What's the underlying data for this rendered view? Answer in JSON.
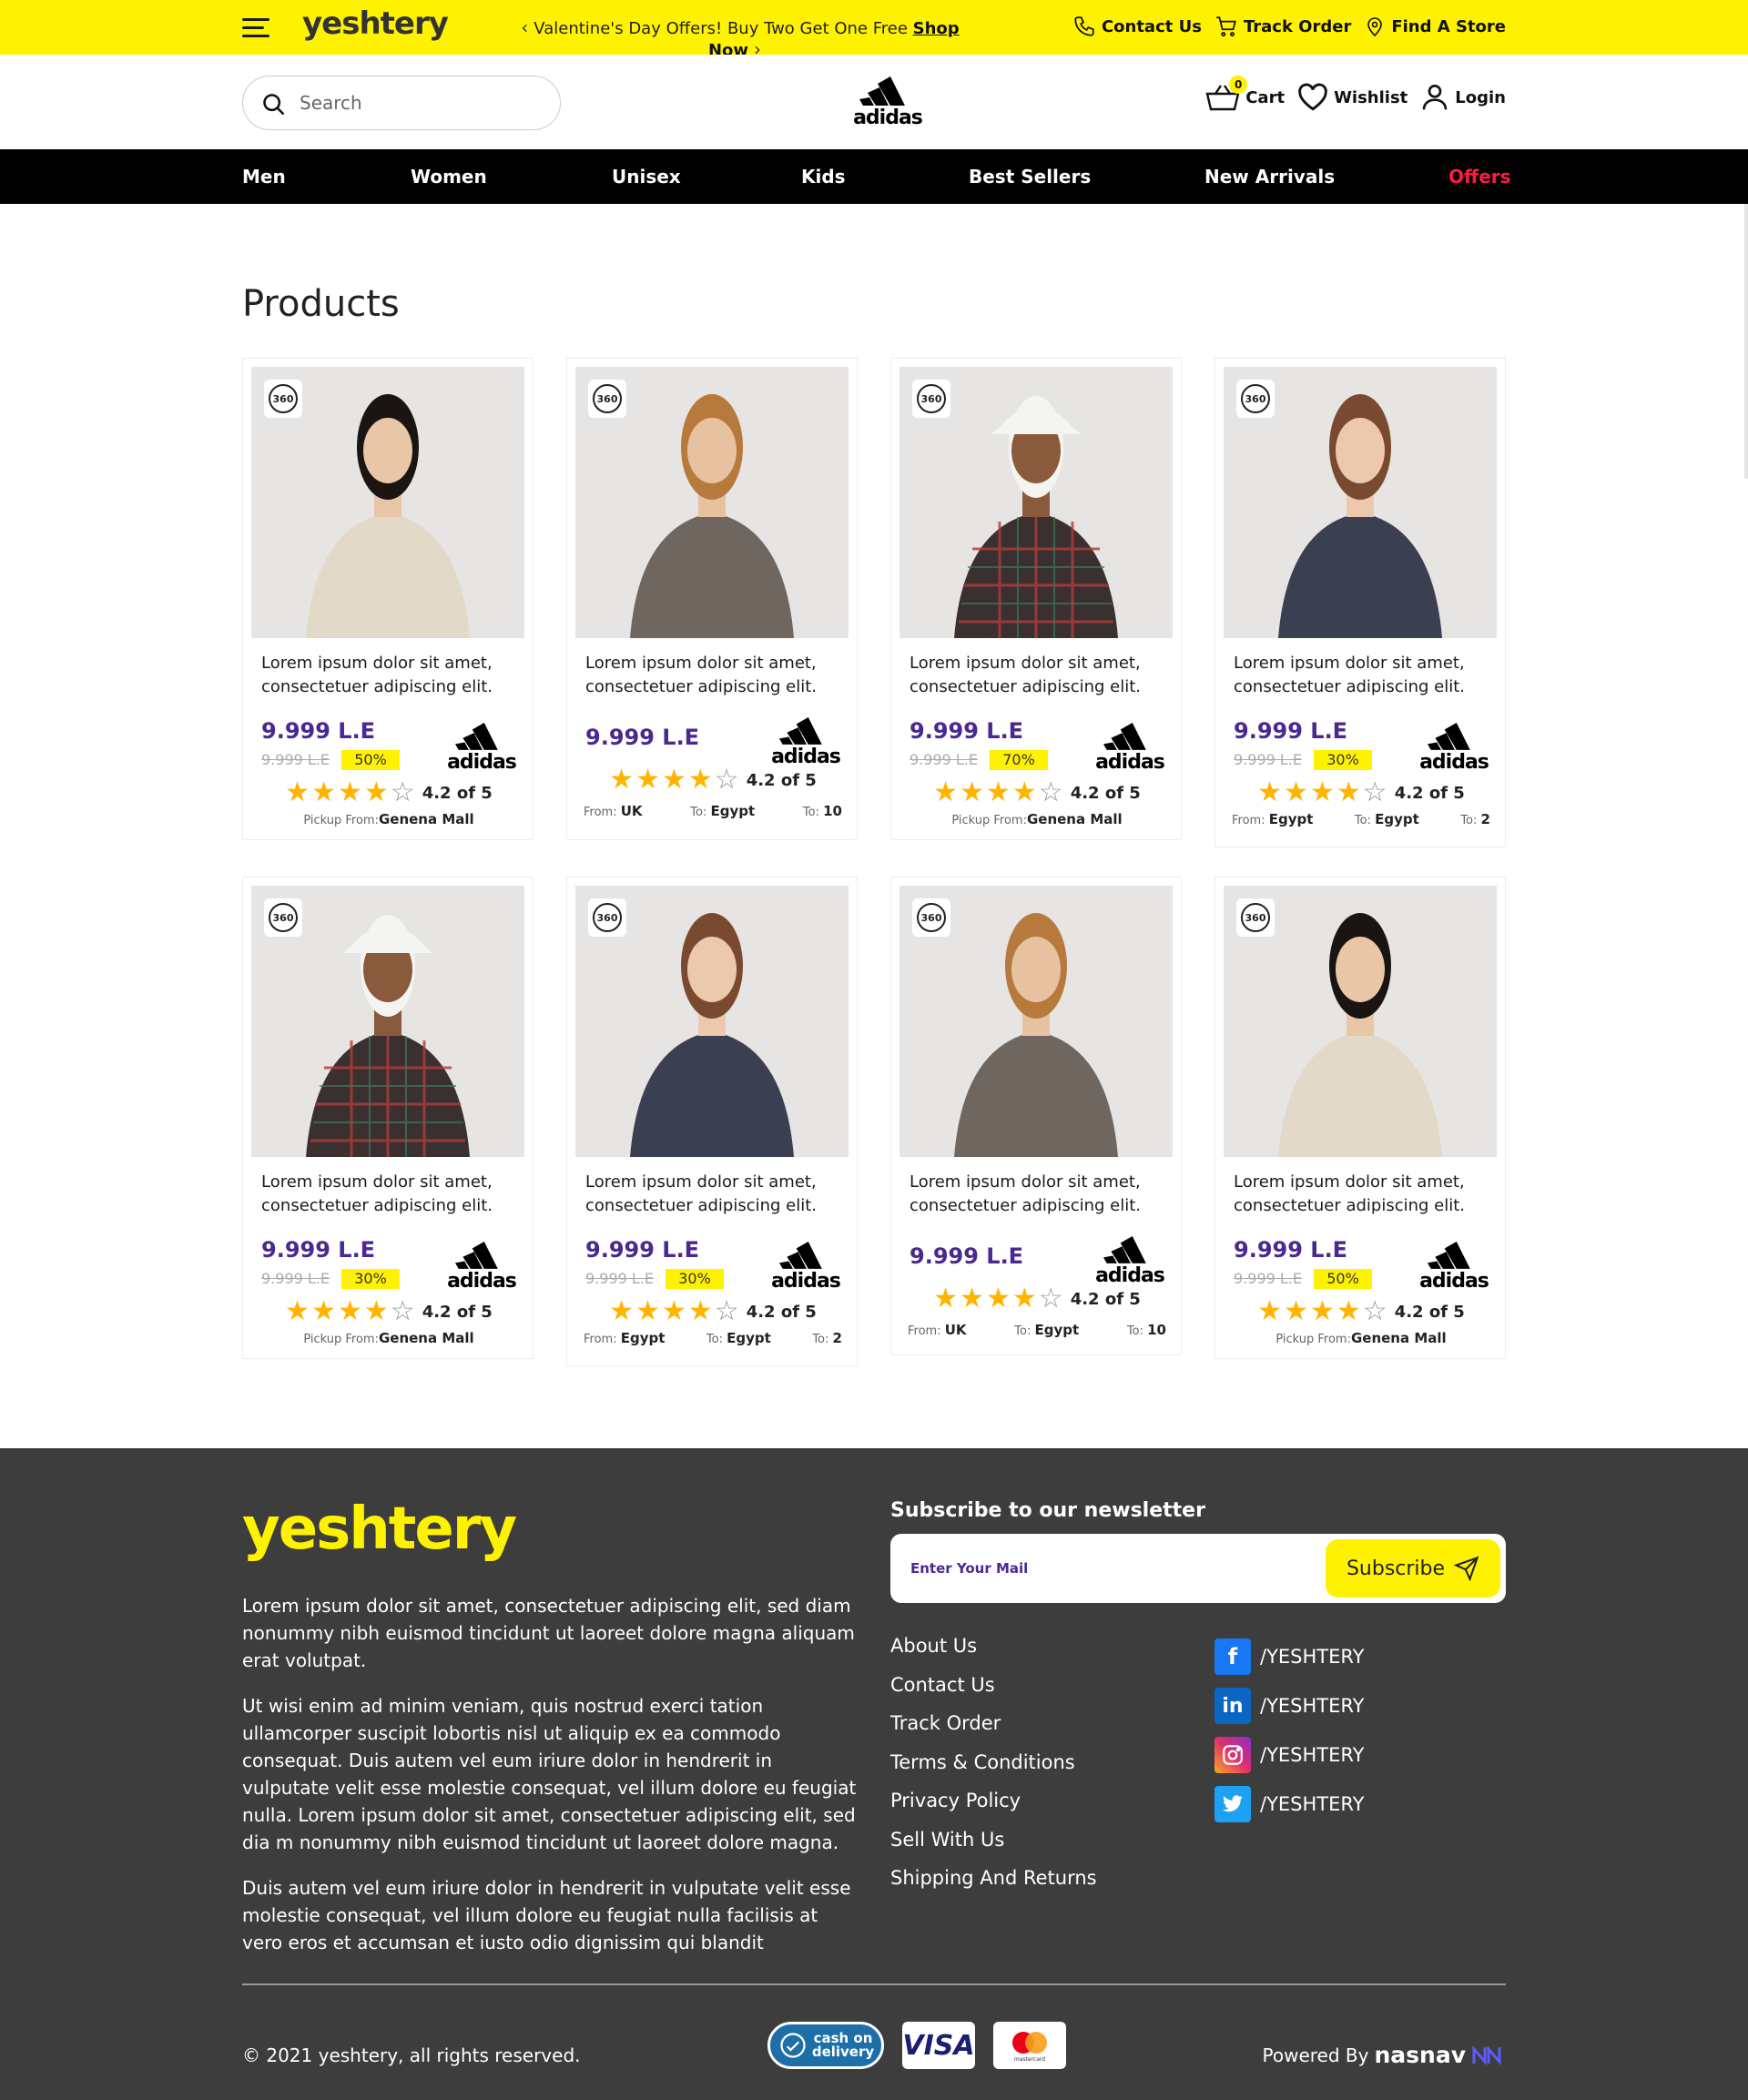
{
  "topbar": {
    "logo": "yeshtery",
    "promo_text": "Valentine's Day Offers! Buy Two Get One Free",
    "promo_link": "Shop Now",
    "links": [
      "Contact Us",
      "Track Order",
      "Find A Store"
    ]
  },
  "header": {
    "search_placeholder": "Search",
    "brand": "adidas",
    "cart_label": "Cart",
    "cart_count": "0",
    "wishlist_label": "Wishlist",
    "login_label": "Login"
  },
  "nav": {
    "items": [
      "Men",
      "Women",
      "Unisex",
      "Kids",
      "Best Sellers",
      "New Arrivals",
      "Offers"
    ],
    "offers_color": "#ff1a3d"
  },
  "page_title": "Products",
  "products": [
    {
      "name": "Lorem ipsum dolor sit amet, consectetuer adipiscing elit.",
      "price": "9.999 L.E",
      "old_price": "9.999 L.E",
      "discount": "50%",
      "brand": "adidas",
      "rating": 4.2,
      "rating_text": "4.2 of 5",
      "pickup_label": "Pickup From:",
      "pickup_location": "Genena Mall",
      "badge": "360"
    },
    {
      "name": "Lorem ipsum dolor sit amet, consectetuer adipiscing elit.",
      "price": "9.999 L.E",
      "brand": "adidas",
      "rating": 4.2,
      "rating_text": "4.2 of 5",
      "from_label": "From:",
      "from": "UK",
      "to_label": "To:",
      "to": "Egypt",
      "to2_label": "To:",
      "to2": "10",
      "badge": "360"
    },
    {
      "name": "Lorem ipsum dolor sit amet, consectetuer adipiscing elit.",
      "price": "9.999 L.E",
      "old_price": "9.999 L.E",
      "discount": "70%",
      "brand": "adidas",
      "rating": 4.2,
      "rating_text": "4.2 of 5",
      "pickup_label": "Pickup From:",
      "pickup_location": "Genena Mall",
      "badge": "360"
    },
    {
      "name": "Lorem ipsum dolor sit amet, consectetuer adipiscing elit.",
      "price": "9.999 L.E",
      "old_price": "9.999 L.E",
      "discount": "30%",
      "brand": "adidas",
      "rating": 4.2,
      "rating_text": "4.2 of 5",
      "from_label": "From:",
      "from": "Egypt",
      "to_label": "To:",
      "to": "Egypt",
      "to2_label": "To:",
      "to2": "2",
      "badge": "360"
    },
    {
      "name": "Lorem ipsum dolor sit amet, consectetuer adipiscing elit.",
      "price": "9.999 L.E",
      "old_price": "9.999 L.E",
      "discount": "30%",
      "brand": "adidas",
      "rating": 4.2,
      "rating_text": "4.2 of 5",
      "pickup_label": "Pickup From:",
      "pickup_location": "Genena Mall",
      "badge": "360"
    },
    {
      "name": "Lorem ipsum dolor sit amet, consectetuer adipiscing elit.",
      "price": "9.999 L.E",
      "old_price": "9.999 L.E",
      "discount": "30%",
      "brand": "adidas",
      "rating": 4.2,
      "rating_text": "4.2 of 5",
      "from_label": "From:",
      "from": "Egypt",
      "to_label": "To:",
      "to": "Egypt",
      "to2_label": "To:",
      "to2": "2",
      "badge": "360"
    },
    {
      "name": "Lorem ipsum dolor sit amet, consectetuer adipiscing elit.",
      "price": "9.999 L.E",
      "brand": "adidas",
      "rating": 4.2,
      "rating_text": "4.2 of 5",
      "from_label": "From:",
      "from": "UK",
      "to_label": "To:",
      "to": "Egypt",
      "to2_label": "To:",
      "to2": "10",
      "badge": "360"
    },
    {
      "name": "Lorem ipsum dolor sit amet, consectetuer adipiscing elit.",
      "price": "9.999 L.E",
      "old_price": "9.999 L.E",
      "discount": "50%",
      "brand": "adidas",
      "rating": 4.2,
      "rating_text": "4.2 of 5",
      "pickup_label": "Pickup From:",
      "pickup_location": "Genena Mall",
      "badge": "360"
    }
  ],
  "footer": {
    "logo": "yeshtery",
    "paragraphs": [
      "Lorem ipsum dolor sit amet, consectetuer adipiscing elit, sed diam nonummy nibh euismod tincidunt ut laoreet dolore magna aliquam erat volutpat.",
      "Ut wisi enim ad minim veniam, quis nostrud exerci tation ullamcorper suscipit lobortis nisl ut aliquip ex ea commodo consequat. Duis autem vel eum iriure dolor in hendrerit in vulputate velit esse molestie consequat, vel illum dolore eu feugiat nulla. Lorem ipsum dolor sit amet, consectetuer adipiscing elit, sed dia m nonummy nibh euismod tincidunt ut laoreet dolore magna.",
      "Duis autem vel eum iriure dolor in hendrerit in vulputate velit esse molestie consequat, vel illum dolore eu feugiat nulla facilisis at vero eros et accumsan et iusto odio dignissim qui blandit"
    ],
    "newsletter_title": "Subscribe to our newsletter",
    "newsletter_placeholder": "Enter Your Mail",
    "subscribe_label": "Subscribe",
    "links": [
      "About Us",
      "Contact Us",
      "Track Order",
      "Terms & Conditions",
      "Privacy Policy",
      "Sell With Us",
      "Shipping And Returns"
    ],
    "social": [
      {
        "icon": "facebook-icon",
        "label": "/YESHTERY",
        "color": "#1877f2"
      },
      {
        "icon": "linkedin-icon",
        "label": "/YESHTERY",
        "color": "#0a66c2"
      },
      {
        "icon": "instagram-icon",
        "label": "/YESHTERY",
        "color": "#e1306c"
      },
      {
        "icon": "twitter-icon",
        "label": "/YESHTERY",
        "color": "#1da1f2"
      }
    ],
    "copyright": "© 2021 yeshtery, all rights reserved.",
    "payments": {
      "cod_line1": "cash on",
      "cod_line2": "delivery",
      "visa": "VISA",
      "mastercard_label": "mastercard"
    },
    "powered_by": "Powered By",
    "powered_brand": "nasnav"
  },
  "colors": {
    "accent_yellow": "#fff200",
    "price_purple": "#4b2891",
    "footer_bg": "#3d3d3d",
    "star": "#ffb400"
  }
}
